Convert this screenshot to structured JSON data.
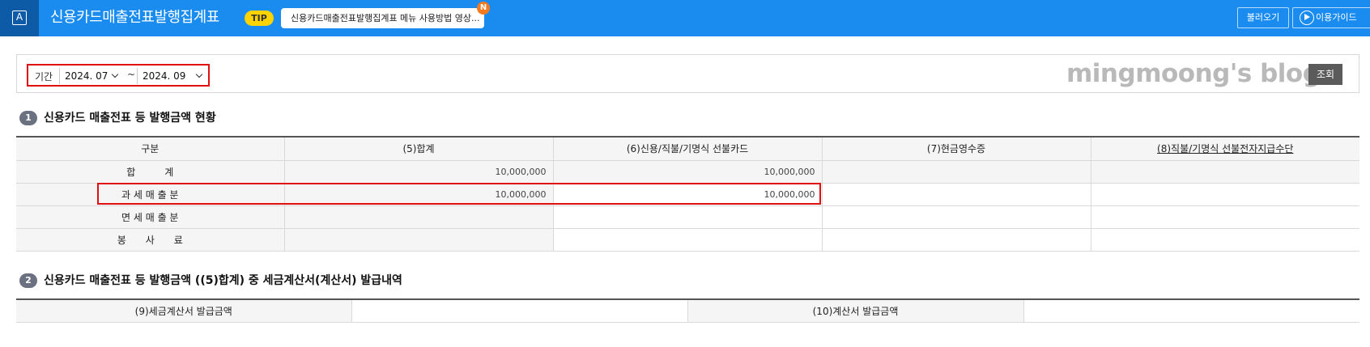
{
  "header": {
    "app_icon_letter": "A",
    "title": "신용카드매출전표발행집계표",
    "tip_badge": "TIP",
    "tip_text": "신용카드매출전표발행집계표 메뉴 사용방법 영상...",
    "new_badge": "N",
    "load_button": "불러오기",
    "guide_button": "이용가이드"
  },
  "search": {
    "period_label": "기간",
    "from_value": "2024. 07",
    "separator": "~",
    "to_value": "2024. 09",
    "watermark": "mingmoong's blog",
    "search_button": "조회"
  },
  "section1": {
    "number": "1",
    "title": "신용카드 매출전표 등 발행금액 현황",
    "headers": [
      "구분",
      "(5)합계",
      "(6)신용/직불/기명식 선불카드",
      "(7)현금영수증",
      "(8)직불/기명식 선불전자지급수단"
    ],
    "rows": [
      {
        "label": "합　　　계",
        "total": "10,000,000",
        "card": "10,000,000",
        "cash": "",
        "prepaid": ""
      },
      {
        "label": "과 세 매 출 분",
        "total": "10,000,000",
        "card": "10,000,000",
        "cash": "",
        "prepaid": ""
      },
      {
        "label": "면 세 매 출 분",
        "total": "",
        "card": "",
        "cash": "",
        "prepaid": ""
      },
      {
        "label": "봉　　사　　료",
        "total": "",
        "card": "",
        "cash": "",
        "prepaid": ""
      }
    ]
  },
  "section2": {
    "number": "2",
    "title": "신용카드 매출전표 등 발행금액 ((5)합계) 중 세금계산서(계산서) 발급내역",
    "tax_invoice_label": "(9)세금계산서 발급금액",
    "tax_invoice_value": "",
    "invoice_label": "(10)계산서 발급금액",
    "invoice_value": ""
  },
  "colors": {
    "header_bg": "#1a8cf0",
    "icon_bg": "#0d5aa7",
    "highlight": "#e01010",
    "tip_badge": "#ffd400",
    "new_badge": "#f47a20"
  }
}
